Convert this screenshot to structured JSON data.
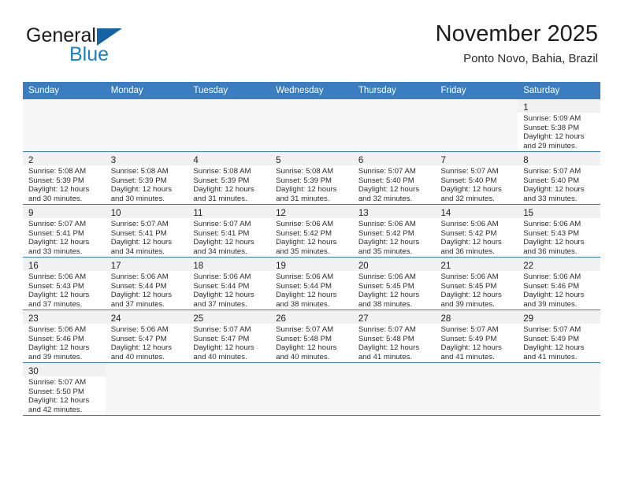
{
  "brand": {
    "line1": "General",
    "line2": "Blue",
    "icon": "triangle-logo"
  },
  "header": {
    "title": "November 2025",
    "subtitle": "Ponto Novo, Bahia, Brazil"
  },
  "colors": {
    "header_blue": "#3a7dc0",
    "brand_blue": "#1c7fc4",
    "logo_blue": "#1463a5",
    "daynum_bg": "#f1f1f1",
    "empty_bg": "#f7f7f7",
    "text": "#222222"
  },
  "weekdays": [
    "Sunday",
    "Monday",
    "Tuesday",
    "Wednesday",
    "Thursday",
    "Friday",
    "Saturday"
  ],
  "labels": {
    "sunrise": "Sunrise:",
    "sunset": "Sunset:",
    "daylight": "Daylight:"
  },
  "weeks": [
    [
      {
        "day": "",
        "empty": true,
        "lines": []
      },
      {
        "day": "",
        "empty": true,
        "lines": []
      },
      {
        "day": "",
        "empty": true,
        "lines": []
      },
      {
        "day": "",
        "empty": true,
        "lines": []
      },
      {
        "day": "",
        "empty": true,
        "lines": []
      },
      {
        "day": "",
        "empty": true,
        "lines": []
      },
      {
        "day": "1",
        "empty": false,
        "lines": [
          "Sunrise: 5:09 AM",
          "Sunset: 5:38 PM",
          "Daylight: 12 hours",
          "and 29 minutes."
        ]
      }
    ],
    [
      {
        "day": "2",
        "empty": false,
        "lines": [
          "Sunrise: 5:08 AM",
          "Sunset: 5:39 PM",
          "Daylight: 12 hours",
          "and 30 minutes."
        ]
      },
      {
        "day": "3",
        "empty": false,
        "lines": [
          "Sunrise: 5:08 AM",
          "Sunset: 5:39 PM",
          "Daylight: 12 hours",
          "and 30 minutes."
        ]
      },
      {
        "day": "4",
        "empty": false,
        "lines": [
          "Sunrise: 5:08 AM",
          "Sunset: 5:39 PM",
          "Daylight: 12 hours",
          "and 31 minutes."
        ]
      },
      {
        "day": "5",
        "empty": false,
        "lines": [
          "Sunrise: 5:08 AM",
          "Sunset: 5:39 PM",
          "Daylight: 12 hours",
          "and 31 minutes."
        ]
      },
      {
        "day": "6",
        "empty": false,
        "lines": [
          "Sunrise: 5:07 AM",
          "Sunset: 5:40 PM",
          "Daylight: 12 hours",
          "and 32 minutes."
        ]
      },
      {
        "day": "7",
        "empty": false,
        "lines": [
          "Sunrise: 5:07 AM",
          "Sunset: 5:40 PM",
          "Daylight: 12 hours",
          "and 32 minutes."
        ]
      },
      {
        "day": "8",
        "empty": false,
        "lines": [
          "Sunrise: 5:07 AM",
          "Sunset: 5:40 PM",
          "Daylight: 12 hours",
          "and 33 minutes."
        ]
      }
    ],
    [
      {
        "day": "9",
        "empty": false,
        "lines": [
          "Sunrise: 5:07 AM",
          "Sunset: 5:41 PM",
          "Daylight: 12 hours",
          "and 33 minutes."
        ]
      },
      {
        "day": "10",
        "empty": false,
        "lines": [
          "Sunrise: 5:07 AM",
          "Sunset: 5:41 PM",
          "Daylight: 12 hours",
          "and 34 minutes."
        ]
      },
      {
        "day": "11",
        "empty": false,
        "lines": [
          "Sunrise: 5:07 AM",
          "Sunset: 5:41 PM",
          "Daylight: 12 hours",
          "and 34 minutes."
        ]
      },
      {
        "day": "12",
        "empty": false,
        "lines": [
          "Sunrise: 5:06 AM",
          "Sunset: 5:42 PM",
          "Daylight: 12 hours",
          "and 35 minutes."
        ]
      },
      {
        "day": "13",
        "empty": false,
        "lines": [
          "Sunrise: 5:06 AM",
          "Sunset: 5:42 PM",
          "Daylight: 12 hours",
          "and 35 minutes."
        ]
      },
      {
        "day": "14",
        "empty": false,
        "lines": [
          "Sunrise: 5:06 AM",
          "Sunset: 5:42 PM",
          "Daylight: 12 hours",
          "and 36 minutes."
        ]
      },
      {
        "day": "15",
        "empty": false,
        "lines": [
          "Sunrise: 5:06 AM",
          "Sunset: 5:43 PM",
          "Daylight: 12 hours",
          "and 36 minutes."
        ]
      }
    ],
    [
      {
        "day": "16",
        "empty": false,
        "lines": [
          "Sunrise: 5:06 AM",
          "Sunset: 5:43 PM",
          "Daylight: 12 hours",
          "and 37 minutes."
        ]
      },
      {
        "day": "17",
        "empty": false,
        "lines": [
          "Sunrise: 5:06 AM",
          "Sunset: 5:44 PM",
          "Daylight: 12 hours",
          "and 37 minutes."
        ]
      },
      {
        "day": "18",
        "empty": false,
        "lines": [
          "Sunrise: 5:06 AM",
          "Sunset: 5:44 PM",
          "Daylight: 12 hours",
          "and 37 minutes."
        ]
      },
      {
        "day": "19",
        "empty": false,
        "lines": [
          "Sunrise: 5:06 AM",
          "Sunset: 5:44 PM",
          "Daylight: 12 hours",
          "and 38 minutes."
        ]
      },
      {
        "day": "20",
        "empty": false,
        "lines": [
          "Sunrise: 5:06 AM",
          "Sunset: 5:45 PM",
          "Daylight: 12 hours",
          "and 38 minutes."
        ]
      },
      {
        "day": "21",
        "empty": false,
        "lines": [
          "Sunrise: 5:06 AM",
          "Sunset: 5:45 PM",
          "Daylight: 12 hours",
          "and 39 minutes."
        ]
      },
      {
        "day": "22",
        "empty": false,
        "lines": [
          "Sunrise: 5:06 AM",
          "Sunset: 5:46 PM",
          "Daylight: 12 hours",
          "and 39 minutes."
        ]
      }
    ],
    [
      {
        "day": "23",
        "empty": false,
        "lines": [
          "Sunrise: 5:06 AM",
          "Sunset: 5:46 PM",
          "Daylight: 12 hours",
          "and 39 minutes."
        ]
      },
      {
        "day": "24",
        "empty": false,
        "lines": [
          "Sunrise: 5:06 AM",
          "Sunset: 5:47 PM",
          "Daylight: 12 hours",
          "and 40 minutes."
        ]
      },
      {
        "day": "25",
        "empty": false,
        "lines": [
          "Sunrise: 5:07 AM",
          "Sunset: 5:47 PM",
          "Daylight: 12 hours",
          "and 40 minutes."
        ]
      },
      {
        "day": "26",
        "empty": false,
        "lines": [
          "Sunrise: 5:07 AM",
          "Sunset: 5:48 PM",
          "Daylight: 12 hours",
          "and 40 minutes."
        ]
      },
      {
        "day": "27",
        "empty": false,
        "lines": [
          "Sunrise: 5:07 AM",
          "Sunset: 5:48 PM",
          "Daylight: 12 hours",
          "and 41 minutes."
        ]
      },
      {
        "day": "28",
        "empty": false,
        "lines": [
          "Sunrise: 5:07 AM",
          "Sunset: 5:49 PM",
          "Daylight: 12 hours",
          "and 41 minutes."
        ]
      },
      {
        "day": "29",
        "empty": false,
        "lines": [
          "Sunrise: 5:07 AM",
          "Sunset: 5:49 PM",
          "Daylight: 12 hours",
          "and 41 minutes."
        ]
      }
    ],
    [
      {
        "day": "30",
        "empty": false,
        "lines": [
          "Sunrise: 5:07 AM",
          "Sunset: 5:50 PM",
          "Daylight: 12 hours",
          "and 42 minutes."
        ]
      },
      {
        "day": "",
        "empty": true,
        "lines": []
      },
      {
        "day": "",
        "empty": true,
        "lines": []
      },
      {
        "day": "",
        "empty": true,
        "lines": []
      },
      {
        "day": "",
        "empty": true,
        "lines": []
      },
      {
        "day": "",
        "empty": true,
        "lines": []
      },
      {
        "day": "",
        "empty": true,
        "lines": []
      }
    ]
  ]
}
